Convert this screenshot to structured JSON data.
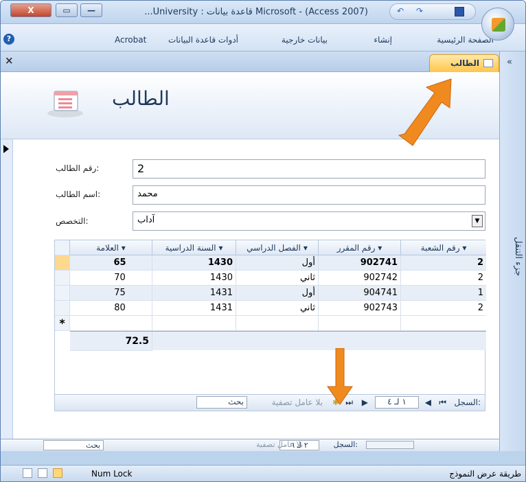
{
  "window": {
    "title": "Microsoft - (Access 2007) قاعدة بيانات : University...",
    "close_glyph": "X"
  },
  "ribbon_tabs": [
    "الصفحة الرئيسية",
    "إنشاء",
    "بيانات خارجية",
    "أدوات قاعدة البيانات",
    "Acrobat"
  ],
  "document_tab": {
    "label": "الطالب",
    "close_glyph": "×"
  },
  "nav_pane": {
    "label": "جزء التنقل",
    "collapse_glyph": "«"
  },
  "form": {
    "title": "الطالب",
    "fields": [
      {
        "label": "رقم الطالب:",
        "value": "2"
      },
      {
        "label": "اسم الطالب:",
        "value": "محمد"
      },
      {
        "label": "التخصص:",
        "value": "آداب"
      }
    ]
  },
  "subform": {
    "columns": [
      "رقم الشعبة",
      "رقم المقرر",
      "الفصل الدراسي",
      "السنة الدراسية",
      "العلامة"
    ],
    "rows": [
      [
        "2",
        "902741",
        "أول",
        "1430",
        "65"
      ],
      [
        "2",
        "902742",
        "ثاني",
        "1430",
        "70"
      ],
      [
        "1",
        "904741",
        "أول",
        "1431",
        "75"
      ],
      [
        "2",
        "902743",
        "ثاني",
        "1431",
        "80"
      ]
    ],
    "new_row_marker": "*",
    "total": "72.5",
    "navigator": {
      "label": "السجل:",
      "position": "١ لـ ٤",
      "filter": "بلا عامل تصفية",
      "search": "بحث"
    }
  },
  "main_navigator": {
    "label": "السجل:",
    "position": "٢ لـ ٦",
    "filter": "بلا عامل تصفية",
    "search": "بحث"
  },
  "status": {
    "mode": "طريقة عرض النموذج",
    "num_lock": "Num Lock"
  },
  "colors": {
    "accent": "#ffc64d",
    "arrow": "#f08a1e",
    "frame": "#bcd3ec"
  }
}
